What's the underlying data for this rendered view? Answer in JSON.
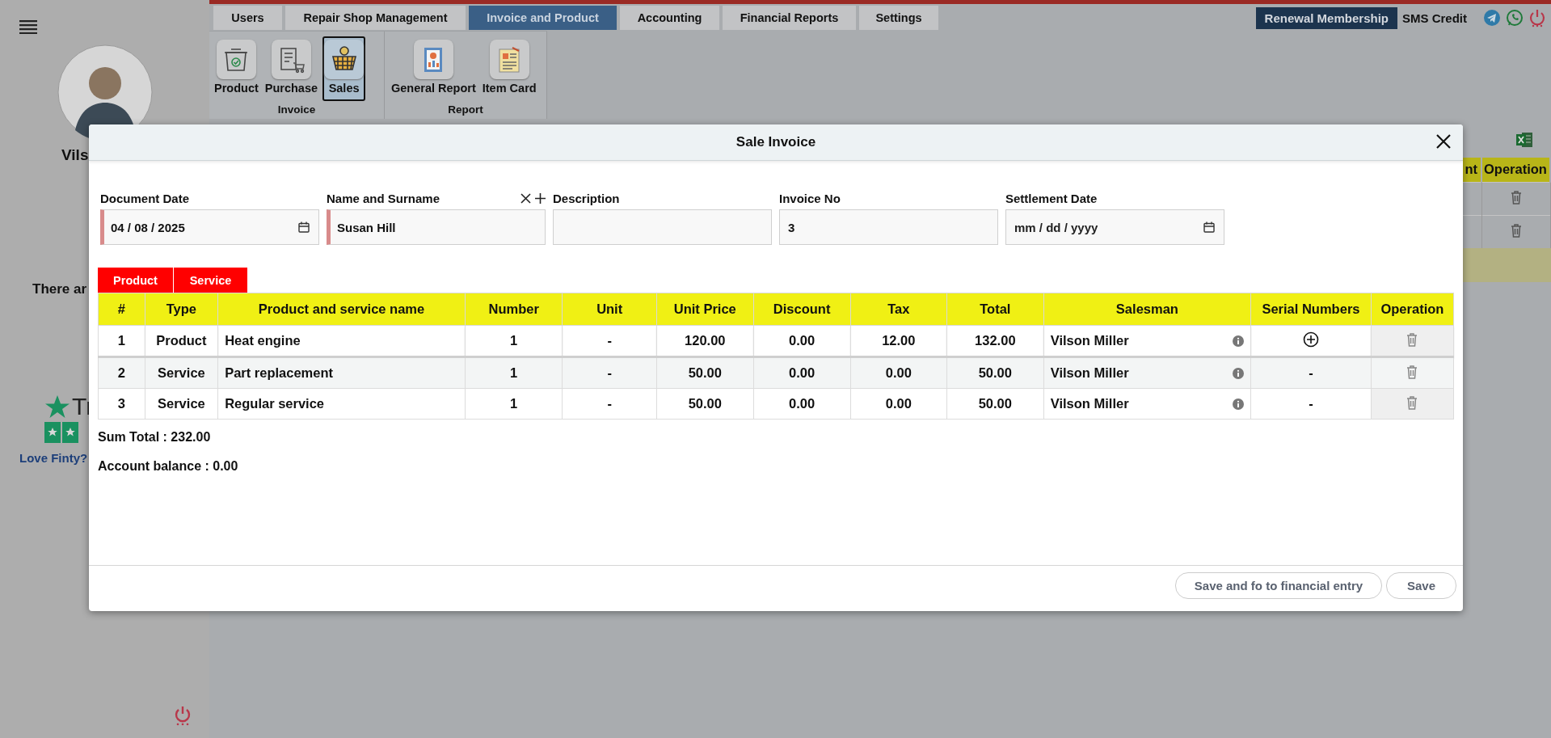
{
  "sidebar": {
    "user_name": "Vils",
    "notice": "There ar",
    "trust_text": "Tr",
    "love_link": "Love Finty?"
  },
  "top_tabs": [
    {
      "label": "Users",
      "selected": false
    },
    {
      "label": "Repair Shop Management",
      "selected": false
    },
    {
      "label": "Invoice and Product",
      "selected": true
    },
    {
      "label": "Accounting",
      "selected": false
    },
    {
      "label": "Financial Reports",
      "selected": false
    },
    {
      "label": "Settings",
      "selected": false
    }
  ],
  "header_actions": {
    "renewal_button": "Renewal Membership",
    "sms_credit": "SMS Credit"
  },
  "ribbon": [
    {
      "label": "Invoice",
      "items": [
        {
          "label": "Product",
          "kind": "box",
          "selected": false
        },
        {
          "label": "Purchase",
          "kind": "cart",
          "selected": false
        },
        {
          "label": "Sales",
          "kind": "basket",
          "selected": true
        }
      ]
    },
    {
      "label": "Report",
      "items": [
        {
          "label": "General Report",
          "kind": "report",
          "selected": false
        },
        {
          "label": "Item Card",
          "kind": "card",
          "selected": false
        }
      ]
    }
  ],
  "background_table": {
    "columns": [
      "nt",
      "Operation"
    ]
  },
  "dialog": {
    "title": "Sale Invoice",
    "fields": [
      {
        "label": "Document Date",
        "kind": "date",
        "required": true,
        "value": "04 / 08 / 2025"
      },
      {
        "label": "Name and Surname",
        "kind": "person",
        "required": true,
        "value": "Susan Hill"
      },
      {
        "label": "Description",
        "kind": "text",
        "required": false
      },
      {
        "label": "Invoice No",
        "kind": "text",
        "required": false,
        "value": "3"
      },
      {
        "label": "Settlement Date",
        "kind": "date",
        "required": false,
        "placeholder": "mm / dd / yyyy"
      }
    ],
    "item_tabs": [
      "Product",
      "Service"
    ],
    "table": {
      "columns": [
        "#",
        "Type",
        "Product and service name",
        "Number",
        "Unit",
        "Unit Price",
        "Discount",
        "Tax",
        "Total",
        "Salesman",
        "Serial Numbers",
        "Operation"
      ],
      "rows": [
        {
          "selected": true,
          "cells": [
            "1",
            "Product",
            "Heat engine",
            "1",
            "-",
            "120.00",
            "0.00",
            "12.00",
            "132.00"
          ],
          "salesman": "Vilson Miller",
          "serial_add": true
        },
        {
          "selected": false,
          "cells": [
            "2",
            "Service",
            "Part replacement",
            "1",
            "-",
            "50.00",
            "0.00",
            "0.00",
            "50.00"
          ],
          "salesman": "Vilson Miller",
          "serial_add": false,
          "serial": "-"
        },
        {
          "selected": false,
          "cells": [
            "3",
            "Service",
            "Regular service",
            "1",
            "-",
            "50.00",
            "0.00",
            "0.00",
            "50.00"
          ],
          "salesman": "Vilson Miller",
          "serial_add": false,
          "serial": "-"
        }
      ]
    },
    "sum_total": "Sum Total : 232.00",
    "account_balance": "Account balance : 0.00",
    "buttons": [
      "Save and fo to financial entry",
      "Save"
    ]
  }
}
